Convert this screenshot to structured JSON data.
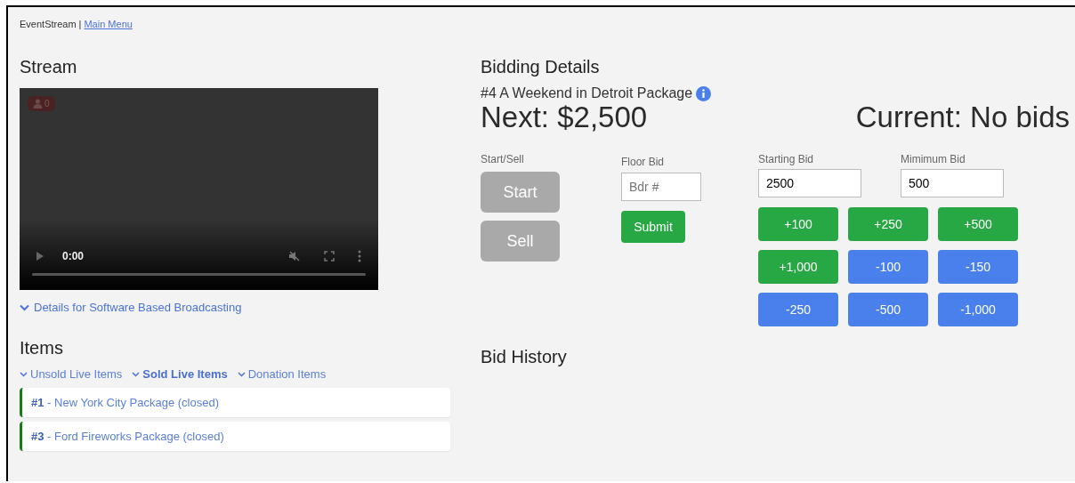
{
  "header": {
    "brand": "EventStream",
    "separator": "|",
    "link": "Main Menu"
  },
  "stream": {
    "title": "Stream",
    "viewers": "0",
    "time": "0:00",
    "progress": {
      "level": 0
    },
    "details_link": "Details for Software Based Broadcasting"
  },
  "items": {
    "title": "Items",
    "filters": [
      {
        "label": "Unsold Live Items",
        "selected": false
      },
      {
        "label": "Sold Live Items",
        "selected": true
      },
      {
        "label": "Donation Items",
        "selected": false
      }
    ],
    "list": [
      {
        "number": "#1",
        "name": " - New York City Package (closed)"
      },
      {
        "number": "#3",
        "name": " - Ford Fireworks Package (closed)"
      }
    ]
  },
  "bidding": {
    "title": "Bidding Details",
    "item": "#4 A Weekend in Detroit Package",
    "next": "Next: $2,500",
    "current": "Current: No bids",
    "start_sell_label": "Start/Sell",
    "start_sell": [
      {
        "label": "Start",
        "disabled": true
      },
      {
        "label": "Sell",
        "disabled": true
      }
    ],
    "floor_bid": {
      "label": "Floor Bid",
      "placeholder": "Bdr #",
      "submit": "Submit"
    },
    "starting_bid": {
      "label": "Starting Bid",
      "value": "2500"
    },
    "minimum_bid": {
      "label": "Mimimum Bid",
      "value": "500"
    },
    "adjust_buttons": [
      {
        "label": "+100",
        "kind": "increase"
      },
      {
        "label": "+250",
        "kind": "increase"
      },
      {
        "label": "+500",
        "kind": "increase"
      },
      {
        "label": "+1,000",
        "kind": "increase"
      },
      {
        "label": "-100",
        "kind": "decrease"
      },
      {
        "label": "-150",
        "kind": "decrease"
      },
      {
        "label": "-250",
        "kind": "decrease"
      },
      {
        "label": "-500",
        "kind": "decrease"
      },
      {
        "label": "-1,000",
        "kind": "decrease"
      }
    ]
  },
  "bid_history": {
    "title": "Bid History"
  }
}
